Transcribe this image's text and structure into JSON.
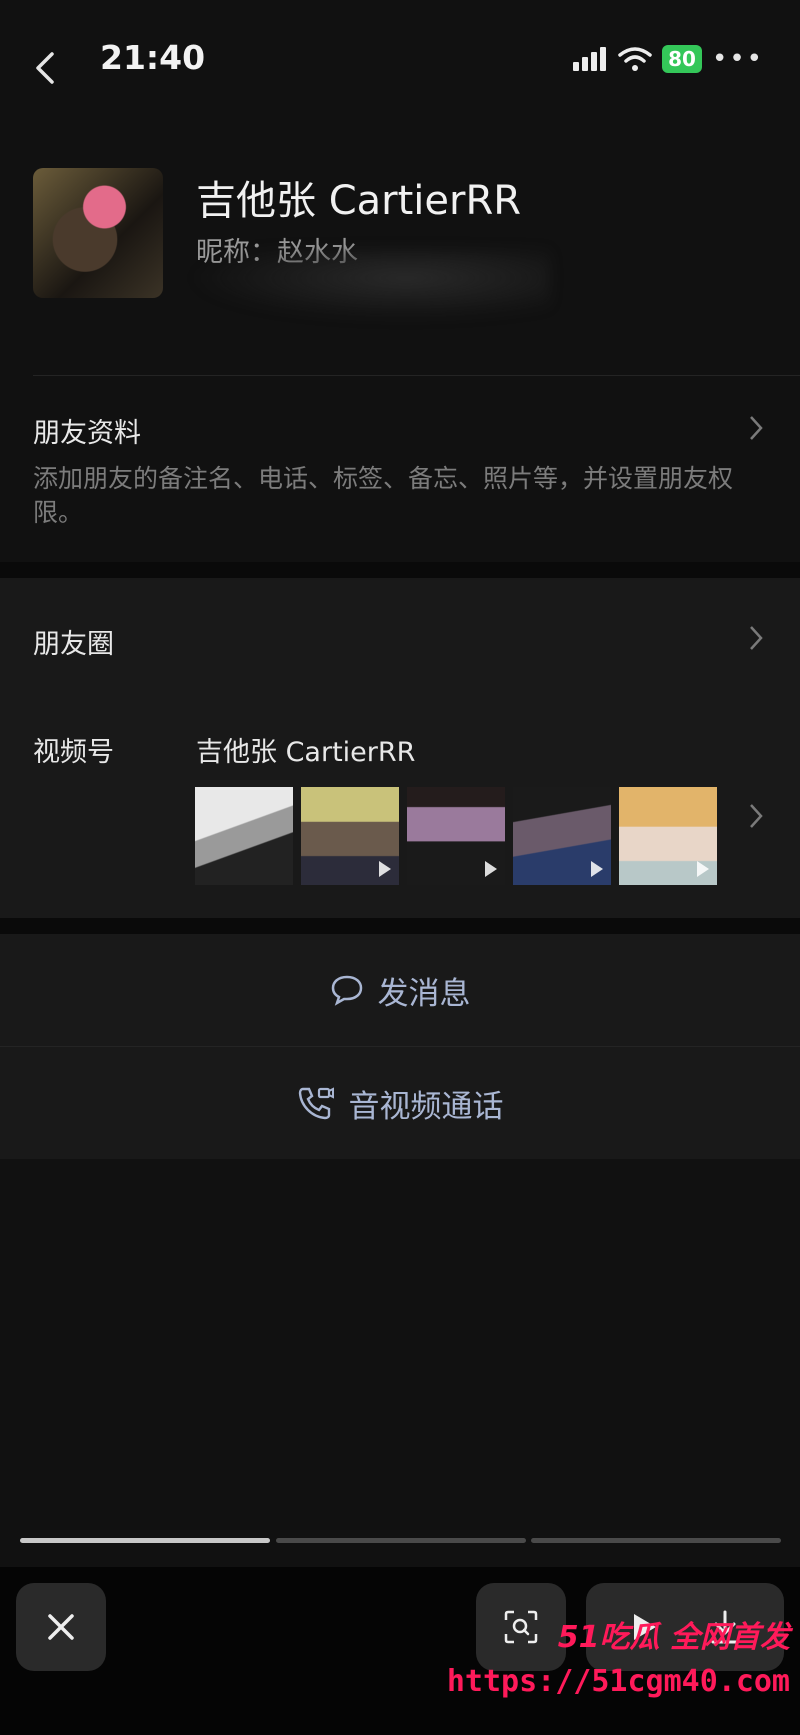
{
  "status_bar": {
    "time": "21:40",
    "battery": "80"
  },
  "profile": {
    "name": "吉他张 CartierRR",
    "nickname": "昵称：赵水水"
  },
  "friend_info": {
    "title": "朋友资料",
    "description": "添加朋友的备注名、电话、标签、备忘、照片等，并设置朋友权限。"
  },
  "moments": {
    "label": "朋友圈"
  },
  "channels": {
    "label": "视频号",
    "name": "吉他张 CartierRR"
  },
  "actions": {
    "send_message": "发消息",
    "av_call": "音视频通话"
  },
  "watermark": {
    "line1": "51吃瓜 全网首发",
    "line2": "https://51cgm40.com"
  },
  "colors": {
    "accent_link": "#a9b6d3",
    "battery": "#34c759",
    "watermark": "#ff1a5a"
  }
}
